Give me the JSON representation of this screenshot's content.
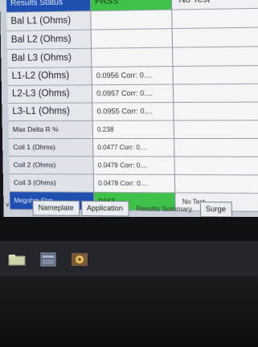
{
  "header": {
    "label": "Results Status",
    "pass": "PASS",
    "none": "No Test"
  },
  "rows": [
    {
      "label": "Bal L1 (Ohms)",
      "value": "",
      "extra": ""
    },
    {
      "label": "Bal L2 (Ohms)",
      "value": "",
      "extra": ""
    },
    {
      "label": "Bal L3 (Ohms)",
      "value": "",
      "extra": ""
    },
    {
      "label": "L1-L2 (Ohms)",
      "value": "0.0956 Corr: 0....",
      "extra": ""
    },
    {
      "label": "L2-L3 (Ohms)",
      "value": "0.0957 Corr: 0....",
      "extra": ""
    },
    {
      "label": "L3-L1 (Ohms)",
      "value": "0.0955 Corr: 0....",
      "extra": ""
    },
    {
      "label": "Max Delta R %",
      "value": "0.238",
      "extra": ""
    },
    {
      "label": "Coil 1 (Ohms)",
      "value": "0.0477 Corr: 0....",
      "extra": ""
    },
    {
      "label": "Coil 2 (Ohms)",
      "value": "0.0479 Corr: 0....",
      "extra": ""
    },
    {
      "label": "Coil 3 (Ohms)",
      "value": "0.0478 Corr: 0....",
      "extra": ""
    }
  ],
  "footer": {
    "label": "Megohm Stat",
    "pass": "PASS",
    "none": "No Test"
  },
  "tabs": [
    "Nameplate",
    "Application",
    "Results Summary",
    "Surge"
  ],
  "icons": [
    "folder-icon",
    "app-window-icon",
    "app-tool-icon"
  ],
  "colors": {
    "pass": "#3fc24a",
    "status": "#1f4fb0"
  }
}
